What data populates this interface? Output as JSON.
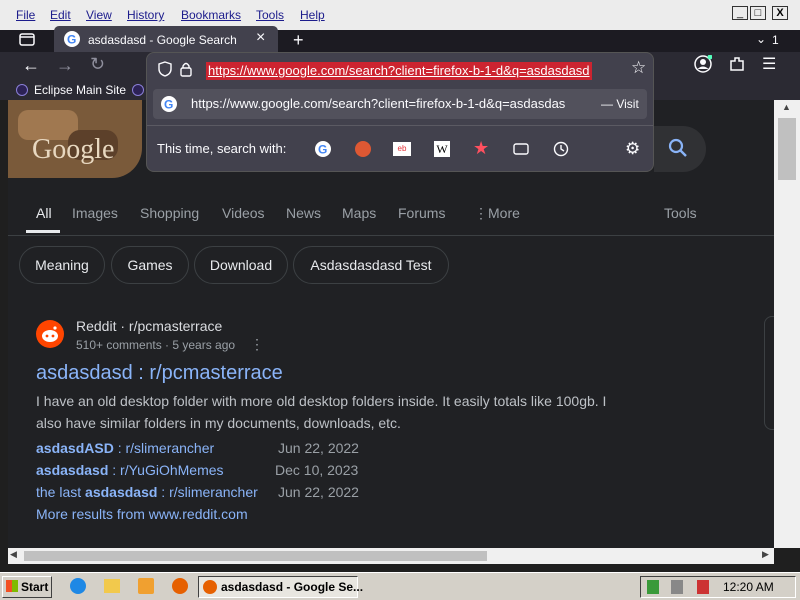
{
  "menubar": {
    "items": [
      "File",
      "Edit",
      "View",
      "History",
      "Bookmarks",
      "Tools",
      "Help"
    ]
  },
  "window_controls": {
    "minimize": "_",
    "maximize": "□",
    "close": "X"
  },
  "tab": {
    "title": "asdasdasd - Google Search",
    "close": "×",
    "new": "+",
    "count": "1"
  },
  "urlbar": {
    "url": "https://www.google.com/search?client=firefox-b-1-d&q=asdasdasd"
  },
  "bookmarks": {
    "items": [
      "Eclipse Main Site"
    ]
  },
  "suggestion": {
    "url": "https://www.google.com/search?client=firefox-b-1-d&q=asdasdas",
    "action": "— Visit"
  },
  "search_with": {
    "label": "This time, search with:"
  },
  "google": {
    "logo": "Google"
  },
  "search_tabs": [
    "All",
    "Images",
    "Shopping",
    "Videos",
    "News",
    "Maps",
    "Forums",
    "More",
    "Tools"
  ],
  "chips": [
    "Meaning",
    "Games",
    "Download",
    "Asdasdasdasd Test"
  ],
  "result": {
    "source": "Reddit · r/pcmasterrace",
    "meta": "510+ comments · 5 years ago",
    "title": "asdasdasd : r/pcmasterrace",
    "snippet": "I have an old desktop folder with more old desktop folders inside. It easily totals like 100gb. I also have similar folders in my documents, downloads, etc.",
    "sublinks": [
      {
        "bold": "asdasdASD",
        "rest": " : r/slimerancher",
        "date": "Jun 22, 2022"
      },
      {
        "bold": "asdasdasd",
        "rest": " : r/YuGiOhMemes",
        "date": "Dec 10, 2023"
      },
      {
        "pre": "the last ",
        "bold": "asdasdasd",
        "rest": " : r/slimerancher",
        "date": "Jun 22, 2022"
      }
    ],
    "more": "More results from www.reddit.com"
  },
  "taskbar": {
    "start": "Start",
    "task": "asdasdasd - Google Se...",
    "time": "12:20 AM"
  }
}
